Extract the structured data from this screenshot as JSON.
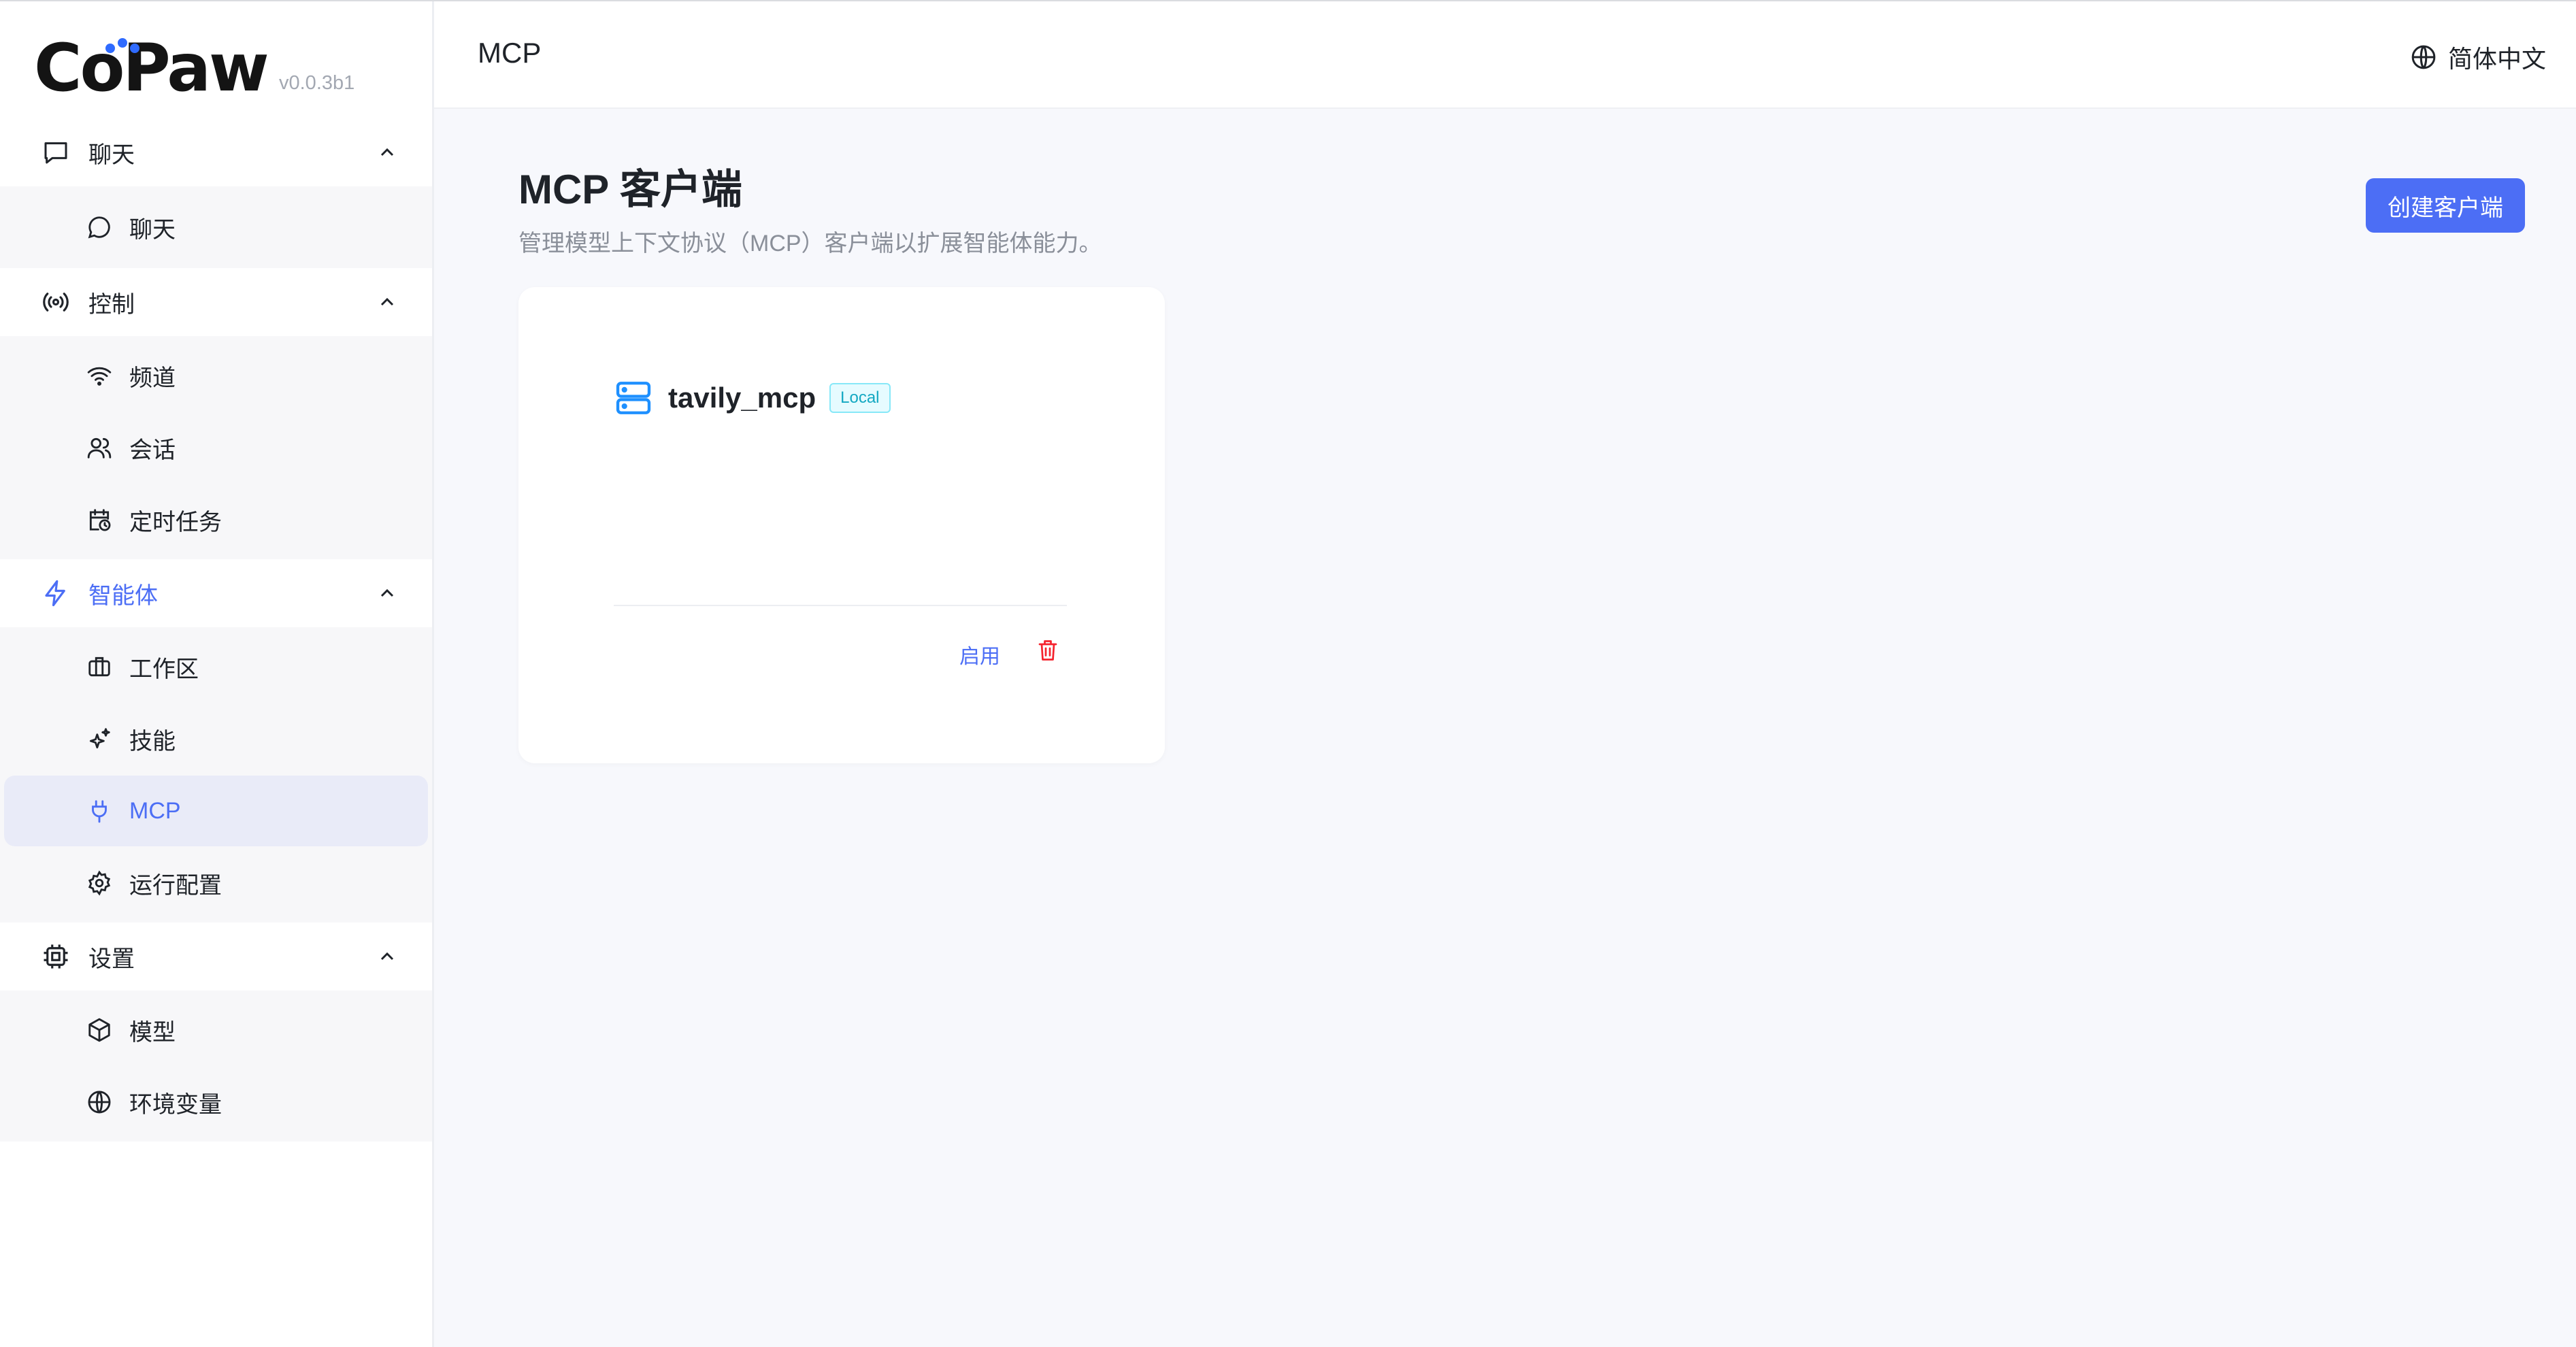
{
  "app": {
    "logo": "CoPaw",
    "version": "v0.0.3b1"
  },
  "header": {
    "title": "MCP",
    "language": "简体中文"
  },
  "sidebar": {
    "groups": [
      {
        "label": "聊天",
        "icon": "chat-bubble-icon",
        "items": [
          {
            "label": "聊天",
            "icon": "chat-circle-icon"
          }
        ]
      },
      {
        "label": "控制",
        "icon": "broadcast-icon",
        "items": [
          {
            "label": "频道",
            "icon": "wifi-icon"
          },
          {
            "label": "会话",
            "icon": "users-icon"
          },
          {
            "label": "定时任务",
            "icon": "calendar-clock-icon"
          }
        ]
      },
      {
        "label": "智能体",
        "icon": "lightning-icon",
        "items": [
          {
            "label": "工作区",
            "icon": "briefcase-icon"
          },
          {
            "label": "技能",
            "icon": "sparkles-icon"
          },
          {
            "label": "MCP",
            "icon": "plug-icon"
          },
          {
            "label": "运行配置",
            "icon": "settings-icon"
          }
        ]
      },
      {
        "label": "设置",
        "icon": "cpu-icon",
        "items": [
          {
            "label": "模型",
            "icon": "cube-icon"
          },
          {
            "label": "环境变量",
            "icon": "globe-icon"
          }
        ]
      }
    ]
  },
  "main": {
    "title": "MCP 客户端",
    "description": "管理模型上下文协议（MCP）客户端以扩展智能体能力。",
    "create_button": "创建客户端",
    "clients": [
      {
        "name": "tavily_mcp",
        "badge": "Local",
        "enable_label": "启用"
      }
    ]
  },
  "colors": {
    "accent": "#4c6ef5",
    "server_icon": "#1e90ff",
    "delete": "#f5222d",
    "badge_text": "#13a8c2"
  }
}
